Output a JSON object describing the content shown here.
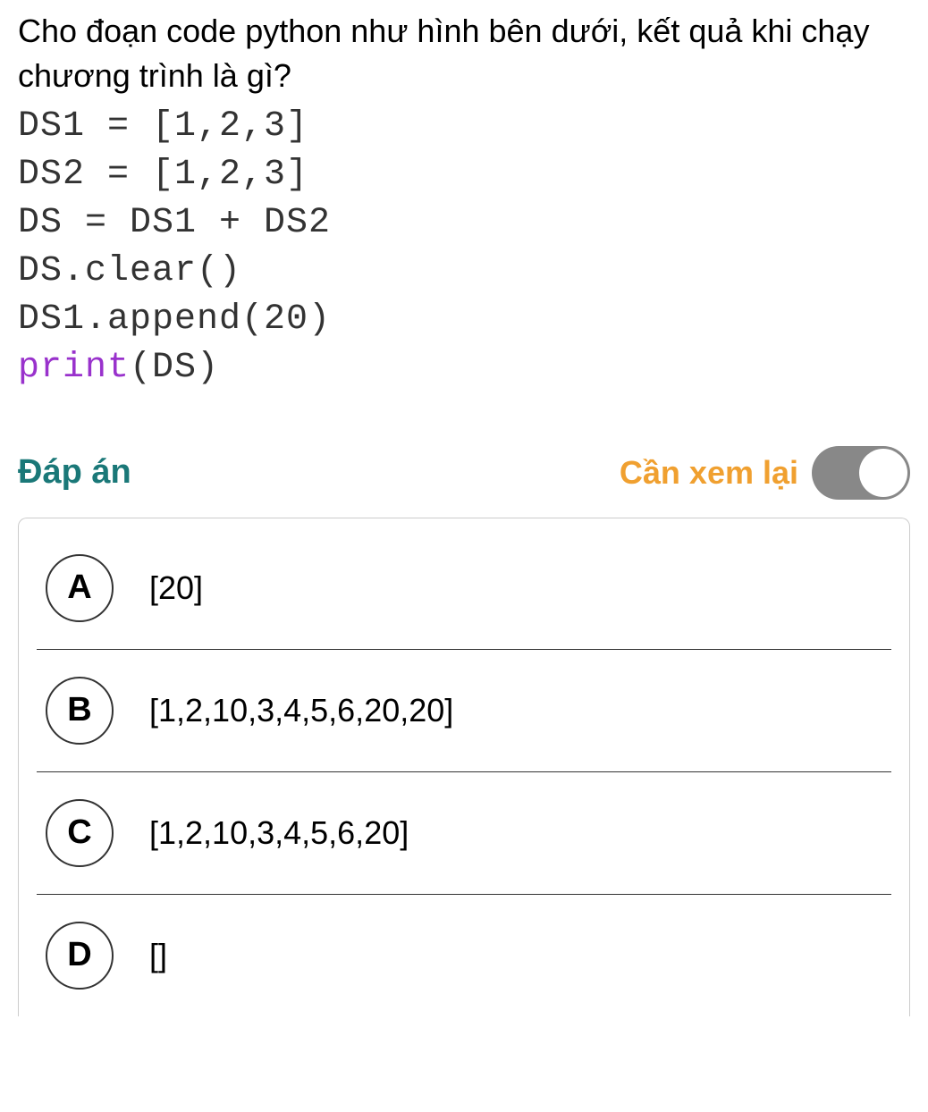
{
  "question": {
    "prompt_line1": " Cho đoạn code python như hình bên dưới, kết quả khi chạy",
    "prompt_line2": "chương trình là gì?",
    "code_lines": [
      "DS1 = [1,2,3]",
      "DS2 = [1,2,3]",
      "DS = DS1 + DS2",
      "DS.clear()",
      "DS1.append(20)"
    ],
    "code_print_keyword": "print",
    "code_print_arg": "(DS)"
  },
  "answer_section": {
    "title": "Đáp án",
    "review_label": "Cần xem lại"
  },
  "options": [
    {
      "letter": "A",
      "text": "[20]"
    },
    {
      "letter": "B",
      "text": "[1,2,10,3,4,5,6,20,20]"
    },
    {
      "letter": "C",
      "text": "[1,2,10,3,4,5,6,20]"
    },
    {
      "letter": "D",
      "text": "[]"
    }
  ]
}
